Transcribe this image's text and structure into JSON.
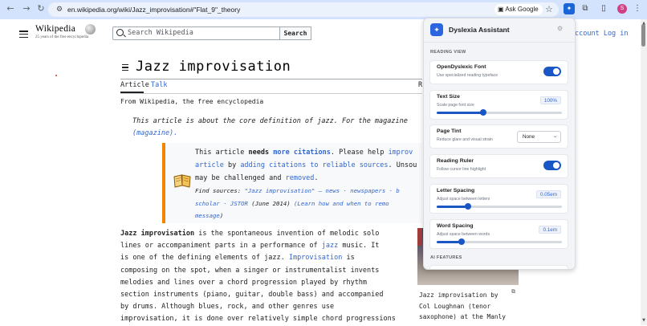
{
  "browser": {
    "url": "en.wikipedia.org/wiki/Jazz_improvisation#\"Flat_9\"_theory",
    "ask_google": "Ask Google",
    "profile_initial": "S"
  },
  "wiki": {
    "logo_word": "Wikipedia",
    "logo_tagline": "25 years of the free encyclopedia",
    "search_placeholder": "Search Wikipedia",
    "search_button": "Search",
    "account_links": "ccount Log in",
    "page_title": "Jazz improvisation",
    "tab_article": "Article",
    "tab_talk": "Talk",
    "tab_right_fragment": "R",
    "from_line": "From Wikipedia, the free encyclopedia",
    "hatnote_line1": "This article is about the core definition of jazz. For the magazine",
    "hatnote_line2": "(magazine).",
    "ambox": {
      "l1_pre": "This article ",
      "l1_bold": "needs ",
      "l1_link": "more citations",
      "l1_post": ". Please help ",
      "l1_link2": "improv",
      "l2_link": "article",
      "l2_mid": " by ",
      "l2_link2": "adding citations to reliable sources",
      "l2_post": ". Unsou",
      "l3_pre": "may be challenged and ",
      "l3_link": "removed",
      "l3_post": ".",
      "l4_pre": "Find sources: ",
      "l4_links": "\"Jazz improvisation\" – news · newspapers · b",
      "l5_link": "scholar · JSTOR",
      "l5_post": " (June 2014) ",
      "l5_link2": "(Learn how and when to remo",
      "l6_link": "message",
      "l6_post": ")"
    },
    "body": {
      "p1_bold": "Jazz improvisation",
      "p1_rest": " is the spontaneous invention of melodic solo",
      "l2_pre": "lines or accompaniment parts in a performance of ",
      "l2_link": "jazz",
      "l2_post": " music. It",
      "l3_pre": "is one of the defining elements of jazz. ",
      "l3_link": "Improvisation",
      "l3_post": " is",
      "l4": "composing on the spot, when a singer or instrumentalist invents",
      "l5": "melodies and lines over a chord progression played by rhythm",
      "l6": "section instruments (piano, guitar, double bass) and accompanied",
      "l7": "by drums. Although blues, rock, and other genres use",
      "l8": "improvisation, it is done over relatively simple chord progressions"
    },
    "caption_lines": [
      "Jazz improvisation by",
      "Col Loughnan (tenor",
      "saxophone) at the Manly"
    ]
  },
  "panel": {
    "title": "Dyslexia Assistant",
    "section_reading": "READING VIEW",
    "section_ai": "AI FEATURES",
    "font": {
      "label": "OpenDyslexic Font",
      "sub": "Use specialized reading typeface",
      "on": true
    },
    "text_size": {
      "label": "Text Size",
      "sub": "Scale page font size",
      "value": "100%",
      "fraction": 0.37
    },
    "tint": {
      "label": "Page Tint",
      "sub": "Reduce glare and visual strain",
      "value": "None"
    },
    "ruler": {
      "label": "Reading Ruler",
      "sub": "Follow cursor line highlight",
      "on": true
    },
    "letter_spacing": {
      "label": "Letter Spacing",
      "sub": "Adjust space between letters",
      "value": "0.05em",
      "fraction": 0.25
    },
    "word_spacing": {
      "label": "Word Spacing",
      "sub": "Adjust space between words",
      "value": "0.1em",
      "fraction": 0.2
    }
  },
  "colors": {
    "accent": "#1a56c4",
    "link": "#3366cc",
    "ambox_border": "#f28500"
  }
}
